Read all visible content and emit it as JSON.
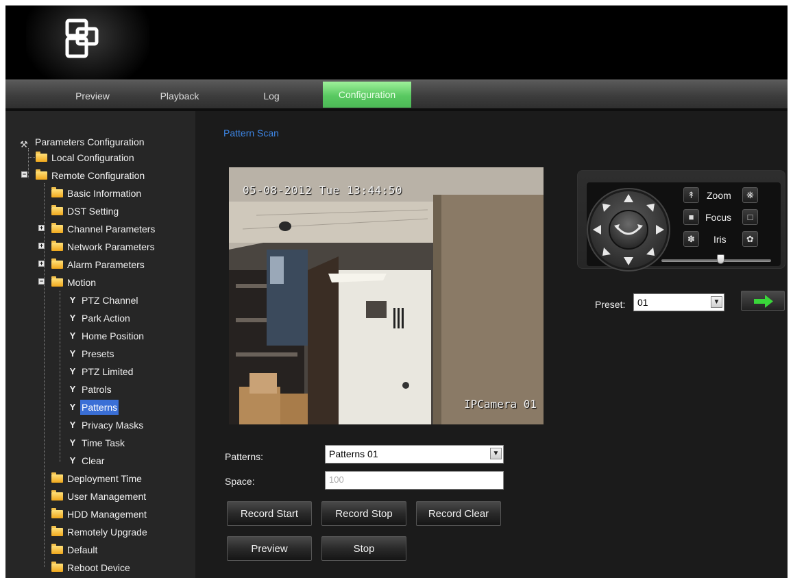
{
  "nav": {
    "tabs": [
      {
        "label": "Preview"
      },
      {
        "label": "Playback"
      },
      {
        "label": "Log"
      },
      {
        "label": "Configuration",
        "active": true
      }
    ]
  },
  "sidebar": {
    "root": "Parameters Configuration",
    "local": "Local Configuration",
    "remote": "Remote Configuration",
    "items": {
      "basic_info": "Basic Information",
      "dst": "DST Setting",
      "channel": "Channel Parameters",
      "network": "Network Parameters",
      "alarm": "Alarm Parameters",
      "motion": "Motion",
      "ptz_channel": "PTZ Channel",
      "park_action": "Park Action",
      "home_position": "Home Position",
      "presets": "Presets",
      "ptz_limited": "PTZ Limited",
      "patrols": "Patrols",
      "patterns": "Patterns",
      "privacy_masks": "Privacy Masks",
      "time_task": "Time Task",
      "clear": "Clear",
      "deployment_time": "Deployment Time",
      "user_management": "User Management",
      "hdd_management": "HDD Management",
      "remotely_upgrade": "Remotely Upgrade",
      "default": "Default",
      "reboot": "Reboot Device"
    },
    "selected": "Patterns"
  },
  "main": {
    "title": "Pattern Scan",
    "video": {
      "timestamp": "05-08-2012 Tue 13:44:50",
      "camera_name": "IPCamera 01"
    },
    "form": {
      "patterns_label": "Patterns:",
      "patterns_value": "Patterns 01",
      "space_label": "Space:",
      "space_value": "100"
    },
    "buttons": {
      "record_start": "Record Start",
      "record_stop": "Record Stop",
      "record_clear": "Record Clear",
      "preview": "Preview",
      "stop": "Stop"
    },
    "ptz": {
      "zoom": "Zoom",
      "focus": "Focus",
      "iris": "Iris",
      "speed_level": 0.54
    },
    "preset": {
      "label": "Preset:",
      "value": "01"
    }
  },
  "colors": {
    "active_tab": "#59c961",
    "title": "#3d86e6",
    "selection": "#3a6fd6",
    "go_arrow": "#39d63a"
  },
  "icons": [
    "app-logo-icon",
    "parameters-config-icon",
    "folder-icon",
    "ptz-pin-icon",
    "zoom-in-icon",
    "zoom-out-icon",
    "focus-near-icon",
    "focus-far-icon",
    "iris-open-icon",
    "iris-close-icon",
    "go-arrow-icon",
    "dropdown-arrow-icon"
  ]
}
